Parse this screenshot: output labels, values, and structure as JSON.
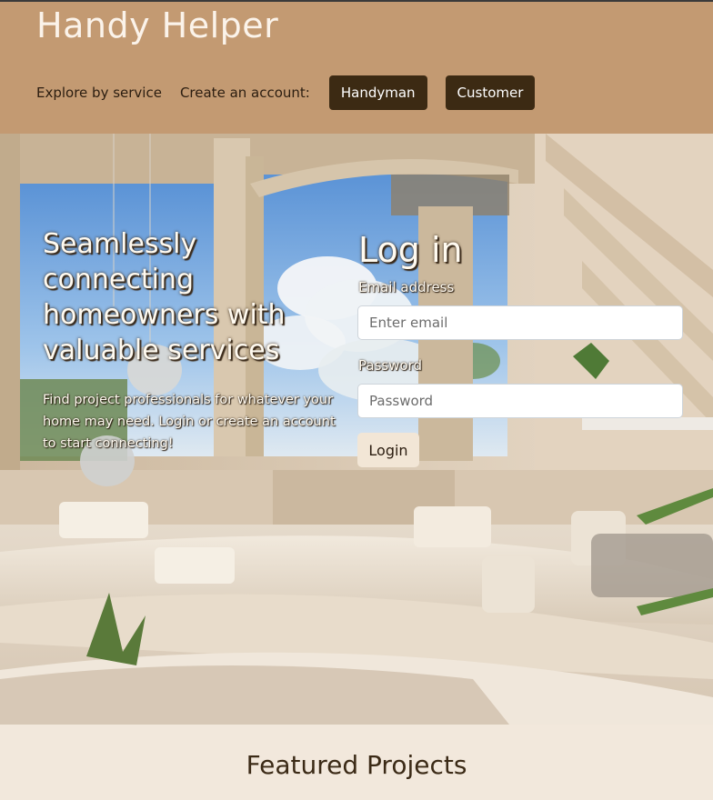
{
  "header": {
    "brand": "Handy Helper",
    "nav": {
      "explore": "Explore by service",
      "create_account": "Create an account:",
      "handyman_button": "Handyman",
      "customer_button": "Customer"
    }
  },
  "hero": {
    "tagline": "Seamlessly connecting homeowners with valuable services",
    "subtext": "Find project professionals for whatever your home may need. Login or create an account to start connecting!"
  },
  "login": {
    "title": "Log in",
    "email_label": "Email address",
    "email_placeholder": "Enter email",
    "password_label": "Password",
    "password_placeholder": "Password",
    "submit_label": "Login"
  },
  "featured": {
    "title": "Featured Projects"
  },
  "colors": {
    "header_bg": "#c39a72",
    "button_dark": "#3c2a13",
    "page_bg": "#f2e8dc"
  }
}
